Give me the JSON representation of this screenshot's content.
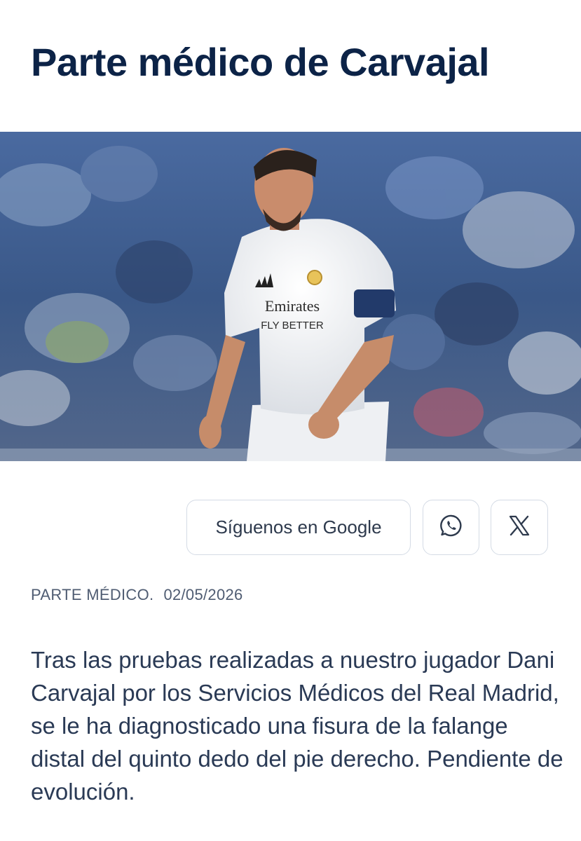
{
  "article": {
    "title": "Parte médico de Carvajal",
    "image": {
      "description_icon": "player-photo",
      "shirt_sponsor_line1": "Emirates",
      "shirt_sponsor_line2": "FLY BETTER"
    },
    "share": {
      "google_label": "Síguenos en Google",
      "whatsapp_icon": "whatsapp-icon",
      "x_icon": "x-logo-icon"
    },
    "category": "PARTE MÉDICO.",
    "date": "02/05/2026",
    "body": "Tras las pruebas realizadas a nuestro jugador Dani Carvajal por los Servicios Médicos del Real Madrid, se le ha diagnosticado una fisura de la falange distal del quinto dedo del pie derecho. Pendiente de evolución."
  },
  "colors": {
    "title": "#0c2347",
    "text": "#2a3a55",
    "meta": "#4f5c72",
    "border": "#d4dbe5"
  }
}
